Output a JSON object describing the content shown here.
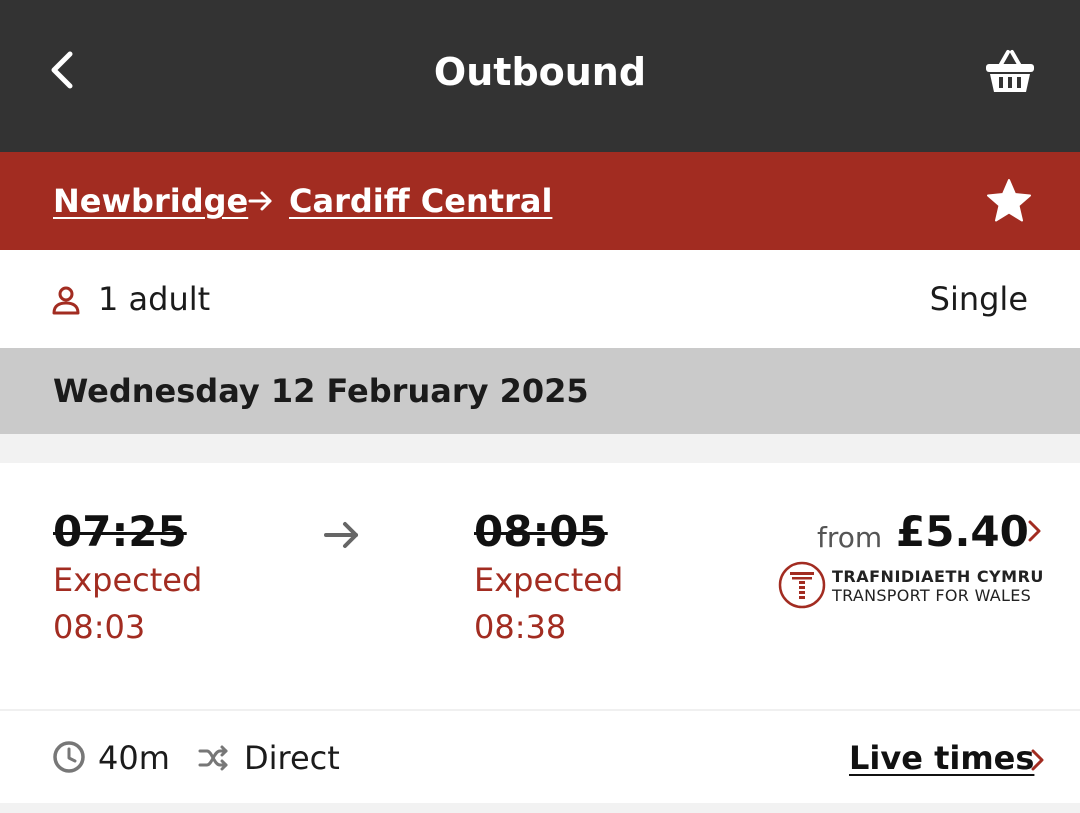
{
  "header": {
    "title": "Outbound",
    "back_icon": "chevron-left-icon",
    "basket_icon": "basket-icon"
  },
  "route": {
    "origin": "Newbridge",
    "destination": "Cardiff Central",
    "arrow_icon": "arrow-right-icon",
    "favourite_icon": "star-icon"
  },
  "passengers": {
    "count_label": "1 adult",
    "ticket_type": "Single",
    "icon": "person-icon"
  },
  "date": {
    "label": "Wednesday 12 February 2025"
  },
  "journey": {
    "departure": {
      "scheduled": "07:25",
      "expected_label": "Expected",
      "expected_time": "08:03"
    },
    "arrival": {
      "scheduled": "08:05",
      "expected_label": "Expected",
      "expected_time": "08:38"
    },
    "price_prefix": "from",
    "price": "£5.40",
    "operator": {
      "line1": "TRAFNIDIAETH CYMRU",
      "line2": "TRANSPORT FOR WALES",
      "logo_icon": "tfw-logo-icon"
    },
    "duration": "40m",
    "changes": "Direct",
    "live_times_label": "Live times"
  },
  "colors": {
    "header_bg": "#333333",
    "brand_red": "#a22c21",
    "date_band": "#cacaca",
    "page_bg": "#f2f2f2"
  }
}
